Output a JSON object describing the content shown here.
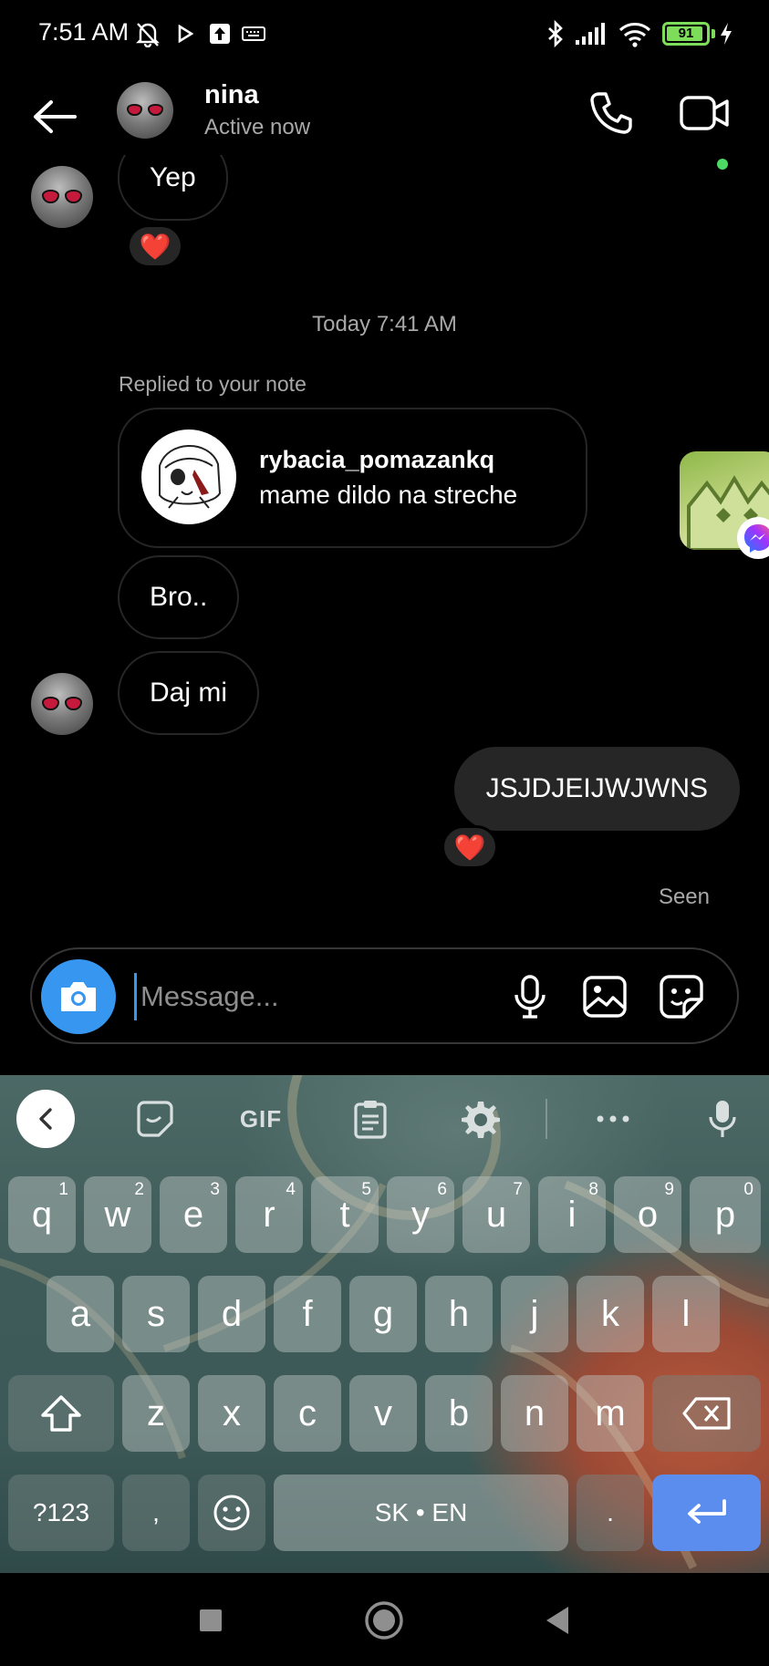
{
  "status_bar": {
    "time": "7:51 AM",
    "battery_level": "91",
    "battery_fraction": 0.91,
    "icons": [
      "mute-bell-icon",
      "play-icon",
      "upload-icon",
      "keyboard-icon",
      "bluetooth-icon",
      "signal-icon",
      "wifi-icon",
      "battery-icon",
      "charging-icon"
    ]
  },
  "header": {
    "contact_name": "nina",
    "contact_status": "Active now"
  },
  "chat": {
    "messages": [
      {
        "side": "received",
        "text": "Yep",
        "reaction": "❤️"
      },
      {
        "side": "received",
        "text": "Bro.."
      },
      {
        "side": "received",
        "text": "Daj mi"
      },
      {
        "side": "sent",
        "text": "JSJDJEIJWJWNS",
        "reaction": "❤️"
      }
    ],
    "timestamp": "Today 7:41 AM",
    "reply_caption": "Replied to your note",
    "note": {
      "username": "rybacia_pomazankq",
      "text": "mame dildo na streche"
    },
    "seen_label": "Seen"
  },
  "composer": {
    "placeholder": "Message..."
  },
  "keyboard": {
    "toolbar": {
      "gif_label": "GIF"
    },
    "row1": [
      {
        "k": "q",
        "h": "1"
      },
      {
        "k": "w",
        "h": "2"
      },
      {
        "k": "e",
        "h": "3"
      },
      {
        "k": "r",
        "h": "4"
      },
      {
        "k": "t",
        "h": "5"
      },
      {
        "k": "y",
        "h": "6"
      },
      {
        "k": "u",
        "h": "7"
      },
      {
        "k": "i",
        "h": "8"
      },
      {
        "k": "o",
        "h": "9"
      },
      {
        "k": "p",
        "h": "0"
      }
    ],
    "row2": [
      "a",
      "s",
      "d",
      "f",
      "g",
      "h",
      "j",
      "k",
      "l"
    ],
    "row3": [
      "z",
      "x",
      "c",
      "v",
      "b",
      "n",
      "m"
    ],
    "symbols_label": "?123",
    "comma_label": ",",
    "space_label": "SK • EN",
    "period_label": "."
  },
  "colors": {
    "accent": "#3797f0",
    "reaction": "#ed2a3f",
    "enter_key": "#5b8def",
    "online_dot": "#4cd964",
    "battery": "#7ddc5a"
  }
}
